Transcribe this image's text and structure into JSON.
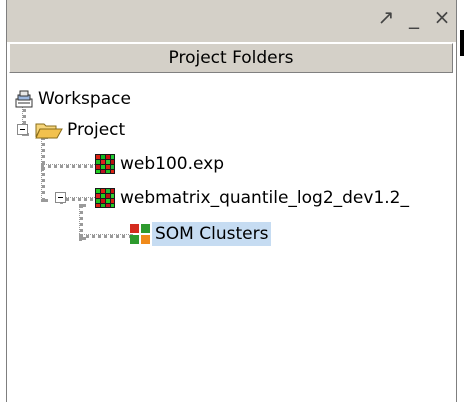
{
  "window": {
    "controls": {
      "float_glyph": "↗",
      "minimize_glyph": "_",
      "close_glyph": "×"
    }
  },
  "panel": {
    "title": "Project Folders"
  },
  "tree": {
    "workspace": "Workspace",
    "project": "Project",
    "items": [
      {
        "label": "web100.exp"
      },
      {
        "label": "webmatrix_quantile_log2_dev1.2_"
      }
    ],
    "child": "SOM Clusters"
  },
  "colors": {
    "selection": "#c6dcf2",
    "panel_bg": "#d4d0c8",
    "folder_yellow": "#f2c14e"
  }
}
